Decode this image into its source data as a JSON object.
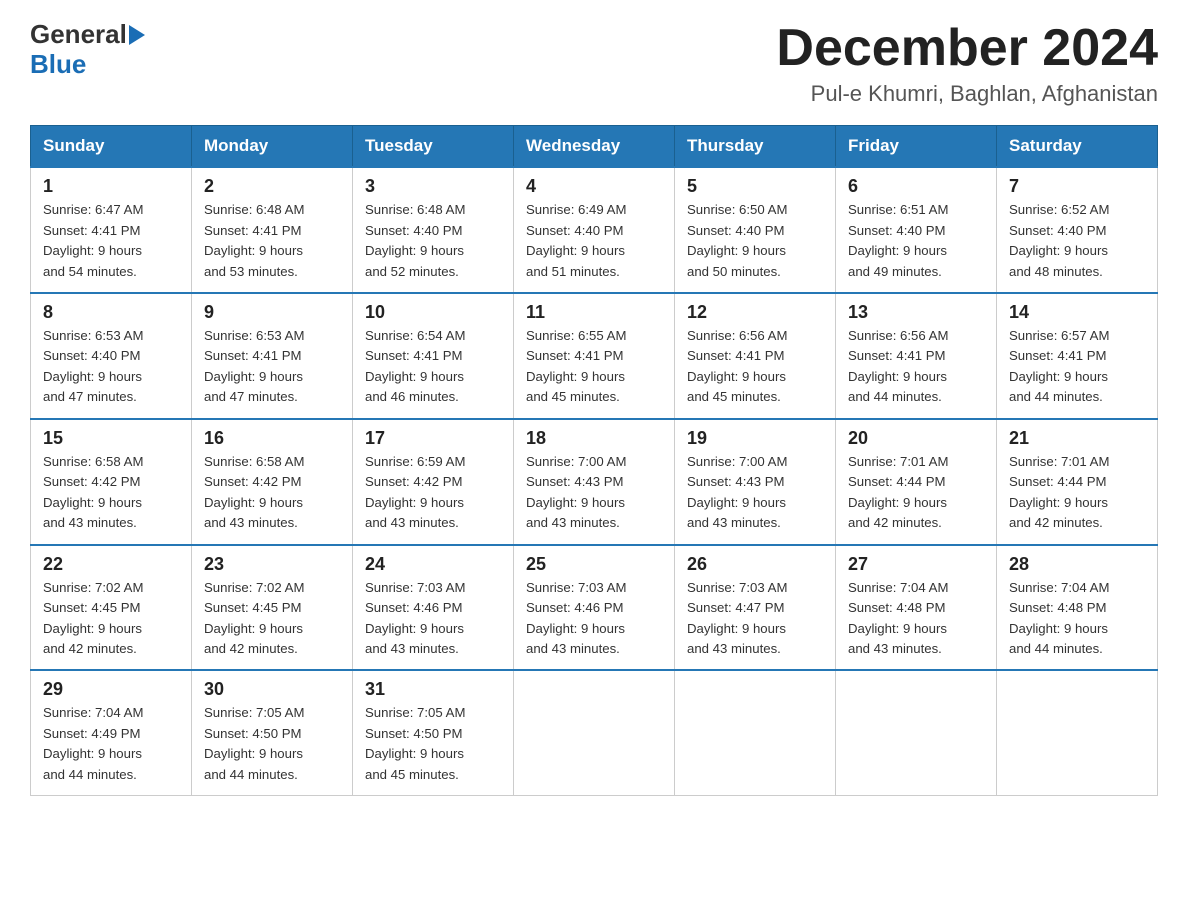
{
  "header": {
    "logo_general": "General",
    "logo_blue": "Blue",
    "month_title": "December 2024",
    "location": "Pul-e Khumri, Baghlan, Afghanistan"
  },
  "weekdays": [
    "Sunday",
    "Monday",
    "Tuesday",
    "Wednesday",
    "Thursday",
    "Friday",
    "Saturday"
  ],
  "weeks": [
    [
      {
        "day": "1",
        "sunrise": "6:47 AM",
        "sunset": "4:41 PM",
        "daylight": "9 hours and 54 minutes."
      },
      {
        "day": "2",
        "sunrise": "6:48 AM",
        "sunset": "4:41 PM",
        "daylight": "9 hours and 53 minutes."
      },
      {
        "day": "3",
        "sunrise": "6:48 AM",
        "sunset": "4:40 PM",
        "daylight": "9 hours and 52 minutes."
      },
      {
        "day": "4",
        "sunrise": "6:49 AM",
        "sunset": "4:40 PM",
        "daylight": "9 hours and 51 minutes."
      },
      {
        "day": "5",
        "sunrise": "6:50 AM",
        "sunset": "4:40 PM",
        "daylight": "9 hours and 50 minutes."
      },
      {
        "day": "6",
        "sunrise": "6:51 AM",
        "sunset": "4:40 PM",
        "daylight": "9 hours and 49 minutes."
      },
      {
        "day": "7",
        "sunrise": "6:52 AM",
        "sunset": "4:40 PM",
        "daylight": "9 hours and 48 minutes."
      }
    ],
    [
      {
        "day": "8",
        "sunrise": "6:53 AM",
        "sunset": "4:40 PM",
        "daylight": "9 hours and 47 minutes."
      },
      {
        "day": "9",
        "sunrise": "6:53 AM",
        "sunset": "4:41 PM",
        "daylight": "9 hours and 47 minutes."
      },
      {
        "day": "10",
        "sunrise": "6:54 AM",
        "sunset": "4:41 PM",
        "daylight": "9 hours and 46 minutes."
      },
      {
        "day": "11",
        "sunrise": "6:55 AM",
        "sunset": "4:41 PM",
        "daylight": "9 hours and 45 minutes."
      },
      {
        "day": "12",
        "sunrise": "6:56 AM",
        "sunset": "4:41 PM",
        "daylight": "9 hours and 45 minutes."
      },
      {
        "day": "13",
        "sunrise": "6:56 AM",
        "sunset": "4:41 PM",
        "daylight": "9 hours and 44 minutes."
      },
      {
        "day": "14",
        "sunrise": "6:57 AM",
        "sunset": "4:41 PM",
        "daylight": "9 hours and 44 minutes."
      }
    ],
    [
      {
        "day": "15",
        "sunrise": "6:58 AM",
        "sunset": "4:42 PM",
        "daylight": "9 hours and 43 minutes."
      },
      {
        "day": "16",
        "sunrise": "6:58 AM",
        "sunset": "4:42 PM",
        "daylight": "9 hours and 43 minutes."
      },
      {
        "day": "17",
        "sunrise": "6:59 AM",
        "sunset": "4:42 PM",
        "daylight": "9 hours and 43 minutes."
      },
      {
        "day": "18",
        "sunrise": "7:00 AM",
        "sunset": "4:43 PM",
        "daylight": "9 hours and 43 minutes."
      },
      {
        "day": "19",
        "sunrise": "7:00 AM",
        "sunset": "4:43 PM",
        "daylight": "9 hours and 43 minutes."
      },
      {
        "day": "20",
        "sunrise": "7:01 AM",
        "sunset": "4:44 PM",
        "daylight": "9 hours and 42 minutes."
      },
      {
        "day": "21",
        "sunrise": "7:01 AM",
        "sunset": "4:44 PM",
        "daylight": "9 hours and 42 minutes."
      }
    ],
    [
      {
        "day": "22",
        "sunrise": "7:02 AM",
        "sunset": "4:45 PM",
        "daylight": "9 hours and 42 minutes."
      },
      {
        "day": "23",
        "sunrise": "7:02 AM",
        "sunset": "4:45 PM",
        "daylight": "9 hours and 42 minutes."
      },
      {
        "day": "24",
        "sunrise": "7:03 AM",
        "sunset": "4:46 PM",
        "daylight": "9 hours and 43 minutes."
      },
      {
        "day": "25",
        "sunrise": "7:03 AM",
        "sunset": "4:46 PM",
        "daylight": "9 hours and 43 minutes."
      },
      {
        "day": "26",
        "sunrise": "7:03 AM",
        "sunset": "4:47 PM",
        "daylight": "9 hours and 43 minutes."
      },
      {
        "day": "27",
        "sunrise": "7:04 AM",
        "sunset": "4:48 PM",
        "daylight": "9 hours and 43 minutes."
      },
      {
        "day": "28",
        "sunrise": "7:04 AM",
        "sunset": "4:48 PM",
        "daylight": "9 hours and 44 minutes."
      }
    ],
    [
      {
        "day": "29",
        "sunrise": "7:04 AM",
        "sunset": "4:49 PM",
        "daylight": "9 hours and 44 minutes."
      },
      {
        "day": "30",
        "sunrise": "7:05 AM",
        "sunset": "4:50 PM",
        "daylight": "9 hours and 44 minutes."
      },
      {
        "day": "31",
        "sunrise": "7:05 AM",
        "sunset": "4:50 PM",
        "daylight": "9 hours and 45 minutes."
      },
      null,
      null,
      null,
      null
    ]
  ],
  "labels": {
    "sunrise": "Sunrise:",
    "sunset": "Sunset:",
    "daylight": "Daylight:"
  }
}
